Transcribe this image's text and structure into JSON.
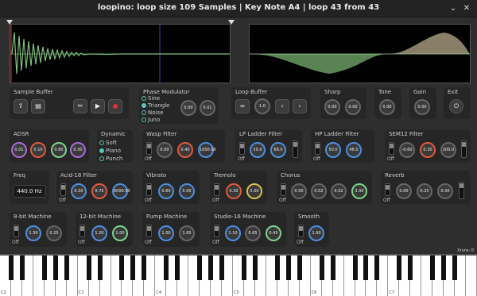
{
  "window": {
    "title": "loopino: loop size 109 Samples | Key Note A4 | loop 43 from 43",
    "min": "⌄",
    "close": "✕"
  },
  "sample_buffer": {
    "title": "Sample Buffer"
  },
  "phase_mod": {
    "title": "Phase Modulator",
    "options": [
      "Sine",
      "Triangle",
      "Noise",
      "Juno"
    ],
    "selected": "Triangle",
    "k1": "0.00",
    "k2": "0.01"
  },
  "loop_buffer": {
    "title": "Loop Buffer",
    "value": "1.0"
  },
  "sharp": {
    "title": "Sharp",
    "k1": "0.00",
    "k2": "0.00"
  },
  "tone": {
    "title": "Tone",
    "k": "0.00"
  },
  "gain": {
    "title": "Gain",
    "k": "0.00"
  },
  "exit": {
    "title": "Exit"
  },
  "adsr": {
    "title": "ADSR",
    "values": [
      "0.01",
      "0.10",
      "0.80",
      "0.30"
    ]
  },
  "dynamic": {
    "title": "Dynamic",
    "options": [
      "Soft",
      "Piano",
      "Punch"
    ],
    "selected": "Piano"
  },
  "wasp": {
    "title": "Wasp Filter",
    "off": "Off",
    "values": [
      "0.00",
      "0.40",
      "1000.00"
    ]
  },
  "lp_ladder": {
    "title": "LP Ladder Filter",
    "off": "Off",
    "values": [
      "50.0",
      "68.0"
    ]
  },
  "hp_ladder": {
    "title": "HP Ladder Filter",
    "off": "Off",
    "values": [
      "50.0",
      "48.0"
    ]
  },
  "sem12": {
    "title": "SEM12 Filter",
    "off": "Off",
    "values": [
      "-0.60",
      "0.30",
      "200.0"
    ]
  },
  "freq": {
    "title": "Freq",
    "value": "440.0 Hz"
  },
  "acid": {
    "title": "Acid-18 Filter",
    "off": "Off",
    "values": [
      "0.30",
      "0.75",
      "6000.00"
    ]
  },
  "vibrato": {
    "title": "Vibrato",
    "off": "Off",
    "values": [
      "0.60",
      "5.00"
    ]
  },
  "tremolo": {
    "title": "Tremolo",
    "off": "Off",
    "values": [
      "0.30",
      "5.00"
    ]
  },
  "chorus": {
    "title": "Chorus",
    "off": "Off",
    "values": [
      "0.50",
      "0.02",
      "0.02",
      "3.00"
    ]
  },
  "reverb": {
    "title": "Reverb",
    "off": "Off",
    "values": [
      "0.00",
      "0.25",
      "0.00"
    ]
  },
  "eightbit": {
    "title": "8-bit Machine",
    "off": "Off",
    "values": [
      "1.30",
      "0.25"
    ]
  },
  "twelvebit": {
    "title": "12-bit Machine",
    "off": "Off",
    "values": [
      "1.20",
      "1.00"
    ]
  },
  "pump": {
    "title": "Pump Machine",
    "off": "Off",
    "values": [
      "1.00",
      "1.65"
    ]
  },
  "studio16": {
    "title": "Studio-16 Machine",
    "off": "Off",
    "values": [
      "1.10",
      "0.65",
      "0.45"
    ]
  },
  "smooth": {
    "title": "Smooth",
    "off": "Off",
    "values": [
      "1.00"
    ]
  },
  "xruns": "Xruns: 0",
  "octaves": [
    "C2",
    "C3",
    "C4",
    "C5",
    "C6",
    "C7"
  ]
}
